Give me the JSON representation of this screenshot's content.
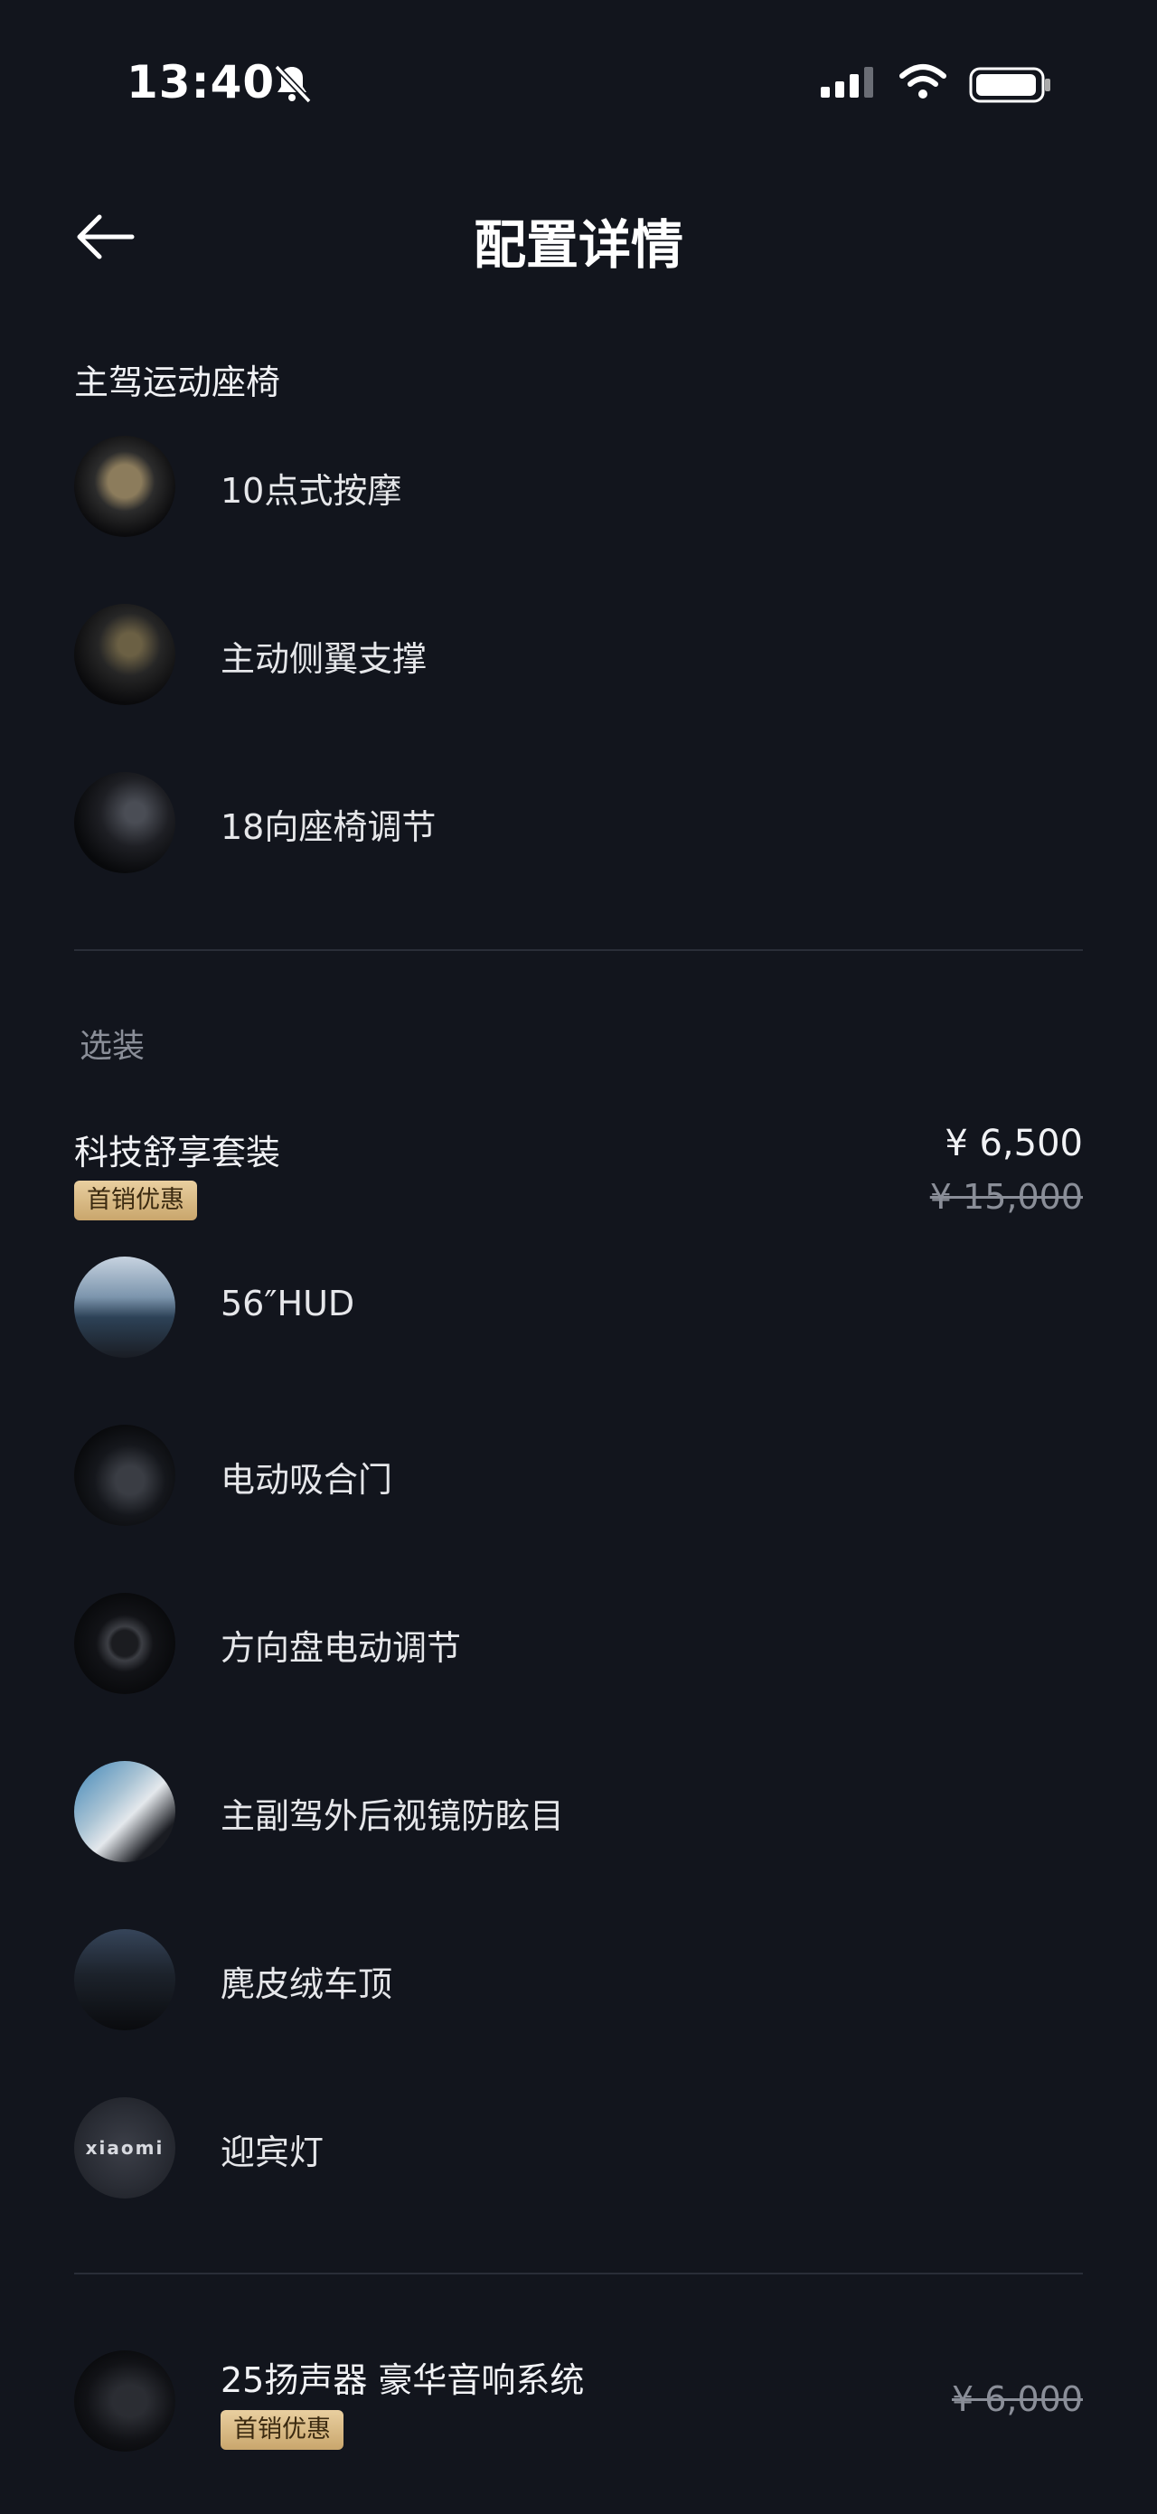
{
  "status_bar": {
    "time": "13:40",
    "icons": [
      "bell-muted-icon",
      "signal-icon",
      "wifi-icon",
      "battery-icon"
    ]
  },
  "header": {
    "back_icon": "arrow-left-icon",
    "title": "配置详情"
  },
  "seat_section": {
    "title": "主驾运动座椅",
    "items": [
      {
        "label": "10点式按摩"
      },
      {
        "label": "主动侧翼支撑"
      },
      {
        "label": "18向座椅调节"
      }
    ]
  },
  "options": {
    "title": "选装",
    "package": {
      "name": "科技舒享套装",
      "badge": "首销优惠",
      "price": "¥ 6,500",
      "original_price": "¥ 15,000",
      "items": [
        {
          "label": "56″HUD"
        },
        {
          "label": "电动吸合门"
        },
        {
          "label": "方向盘电动调节"
        },
        {
          "label": "主副驾外后视镜防眩目"
        },
        {
          "label": "麂皮绒车顶"
        },
        {
          "label": "迎宾灯",
          "icon_text": "xiaomi"
        }
      ]
    },
    "audio": {
      "name": "25扬声器 豪华音响系统",
      "badge": "首销优惠",
      "original_price": "¥ 6,000"
    }
  },
  "colors": {
    "background": "#12151d",
    "badge_gold": "#d9b98a",
    "divider": "#2a2e38"
  }
}
